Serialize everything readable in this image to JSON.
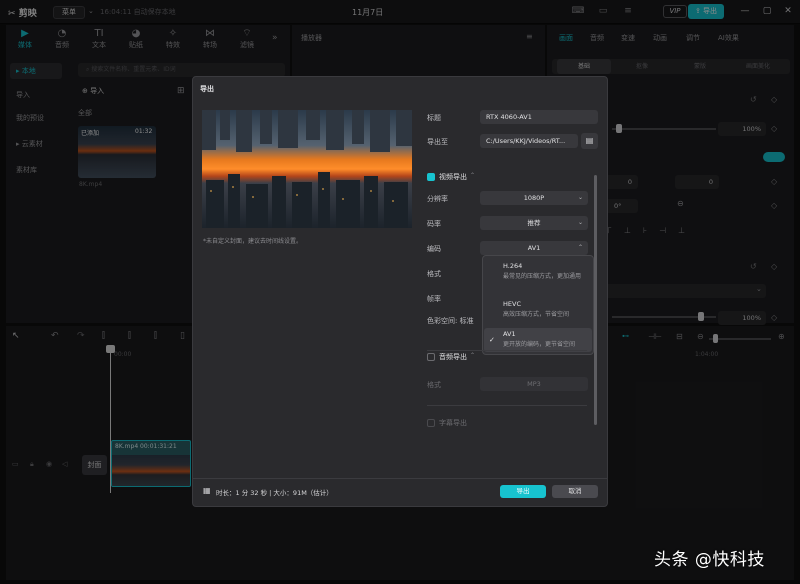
{
  "titlebar": {
    "app_name": "剪映",
    "menu_label": "菜单",
    "autosave": "16:04:11 自动保存本地",
    "date": "11月7日",
    "vip_label": "VIP",
    "export_label": "导出"
  },
  "media_panel": {
    "tools": [
      {
        "label": "媒体",
        "icon": "media-icon"
      },
      {
        "label": "音频",
        "icon": "audio-icon"
      },
      {
        "label": "文本",
        "icon": "text-icon"
      },
      {
        "label": "贴纸",
        "icon": "sticker-icon"
      },
      {
        "label": "特效",
        "icon": "effects-icon"
      },
      {
        "label": "转场",
        "icon": "transition-icon"
      },
      {
        "label": "滤镜",
        "icon": "filter-icon"
      }
    ],
    "sidebar": [
      "本地",
      "导入",
      "我的预设",
      "云素材",
      "素材库"
    ],
    "search_placeholder": "搜索文件名称、重置元素、ID词",
    "import_label": "导入",
    "all_label": "全部",
    "clip": {
      "status": "已添加",
      "duration": "01:32",
      "name": "8K.mp4"
    }
  },
  "player": {
    "title": "播放器"
  },
  "right_panel": {
    "tabs": [
      "画面",
      "音频",
      "变速",
      "动画",
      "调节",
      "AI效果"
    ],
    "segments": [
      "基础",
      "抠像",
      "蒙版",
      "画面美化"
    ],
    "scale_value": "100%",
    "pos_x": "0",
    "pos_y": "0",
    "rotate": "0°",
    "opacity_value": "100%"
  },
  "timeline": {
    "time_start": "00:00",
    "time_mark": "1:04:00",
    "track_clip_label": "8K.mp4   00:01:31:21",
    "cover_label": "封面"
  },
  "dialog": {
    "title": "导出",
    "cover_hint": "*未自定义封面，建议去时间线设置。",
    "title_label": "标题",
    "title_value": "RTX 4060-AV1",
    "export_to_label": "导出至",
    "export_to_value": "C:/Users/KKJ/Videos/RT...",
    "video_export_label": "视频导出",
    "resolution_label": "分辨率",
    "resolution_value": "1080P",
    "bitrate_label": "码率",
    "bitrate_value": "推荐",
    "codec_label": "编码",
    "codec_value": "AV1",
    "format_label": "格式",
    "framerate_label": "帧率",
    "colorspace_label": "色彩空间:",
    "colorspace_value": "标准",
    "codec_options": [
      {
        "name": "H.264",
        "desc": "最常见的压缩方式，更加通用"
      },
      {
        "name": "HEVC",
        "desc": "高效压缩方式，节省空间"
      },
      {
        "name": "AV1",
        "desc": "更开放的编码，更节省空间"
      }
    ],
    "audio_export_label": "音频导出",
    "audio_format_label": "格式",
    "audio_format_value": "MP3",
    "subtitle_export_label": "字幕导出",
    "footer_info": "时长：1 分 32 秒 | 大小：91M（估计）",
    "confirm_label": "导出",
    "cancel_label": "取消"
  },
  "watermark": "头条 @快科技",
  "colors": {
    "accent": "#17c3cf",
    "dialog_bg": "#2a2a2d",
    "panel_bg": "#1d1d1f"
  }
}
